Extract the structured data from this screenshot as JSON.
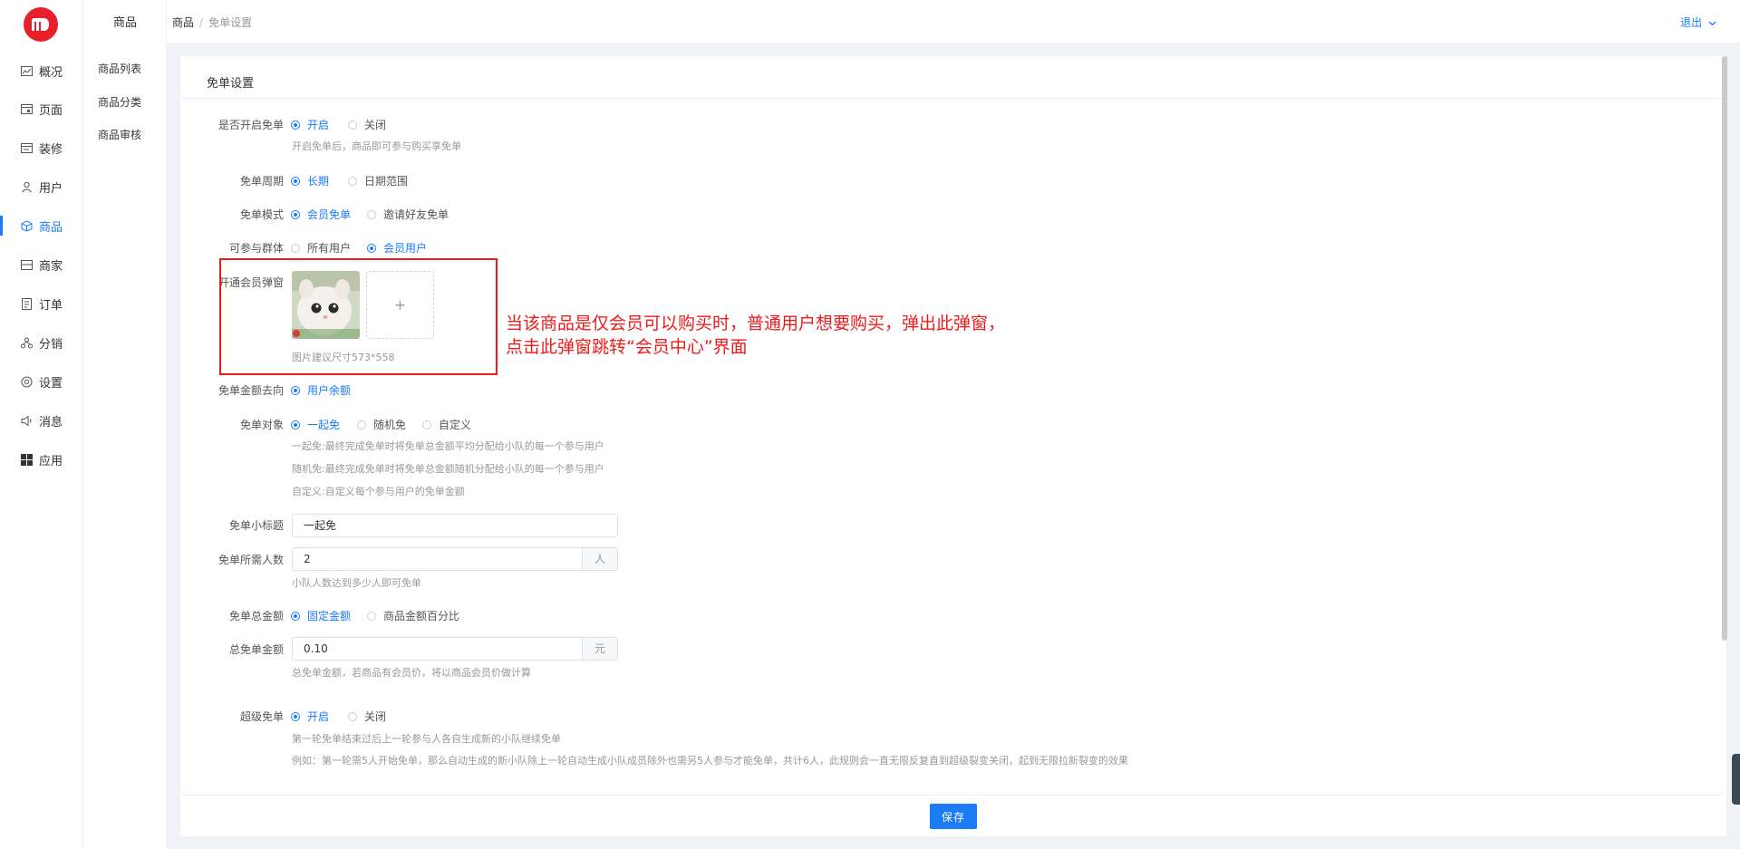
{
  "nav": {
    "items": [
      {
        "label": "概况",
        "icon": "chart-icon"
      },
      {
        "label": "页面",
        "icon": "page-icon"
      },
      {
        "label": "装修",
        "icon": "decorate-icon"
      },
      {
        "label": "用户",
        "icon": "user-icon"
      },
      {
        "label": "商品",
        "icon": "box-icon"
      },
      {
        "label": "商家",
        "icon": "store-icon"
      },
      {
        "label": "订单",
        "icon": "order-icon"
      },
      {
        "label": "分销",
        "icon": "distribution-icon"
      },
      {
        "label": "设置",
        "icon": "settings-icon"
      },
      {
        "label": "消息",
        "icon": "message-icon"
      },
      {
        "label": "应用",
        "icon": "apps-icon"
      }
    ],
    "active": "商品"
  },
  "subnav": {
    "title": "商品",
    "items": [
      "商品列表",
      "商品分类",
      "商品审核"
    ]
  },
  "topbar": {
    "breadcrumb": [
      "商品",
      "免单设置"
    ],
    "logout": "退出"
  },
  "card": {
    "title": "免单设置"
  },
  "form": {
    "enable": {
      "label": "是否开启免单",
      "options": [
        "开启",
        "关闭"
      ],
      "selected": "开启",
      "hint": "开启免单后，商品即可参与购买享免单"
    },
    "period": {
      "label": "免单周期",
      "options": [
        "长期",
        "日期范围"
      ],
      "selected": "长期"
    },
    "mode": {
      "label": "免单模式",
      "options": [
        "会员免单",
        "邀请好友免单"
      ],
      "selected": "会员免单"
    },
    "group": {
      "label": "可参与群体",
      "options": [
        "所有用户",
        "会员用户"
      ],
      "selected": "会员用户"
    },
    "popup": {
      "label": "开通会员弹窗",
      "hint": "图片建议尺寸573*558",
      "upload": "+"
    },
    "destination": {
      "label": "免单金额去向",
      "options": [
        "用户余额"
      ],
      "selected": "用户余额"
    },
    "target": {
      "label": "免单对象",
      "options": [
        "一起免",
        "随机免",
        "自定义"
      ],
      "selected": "一起免",
      "hints": [
        "一起免:最终完成免单时将免单总金额平均分配给小队的每一个参与用户",
        "随机免:最终完成免单时将免单总金额随机分配给小队的每一个参与用户",
        "自定义:自定义每个参与用户的免单金额"
      ]
    },
    "subtitle": {
      "label": "免单小标题",
      "value": "一起免"
    },
    "people": {
      "label": "免单所需人数",
      "value": "2",
      "unit": "人",
      "hint": "小队人数达到多少人即可免单"
    },
    "total_type": {
      "label": "免单总金额",
      "options": [
        "固定金额",
        "商品金额百分比"
      ],
      "selected": "固定金额"
    },
    "total_amount": {
      "label": "总免单金额",
      "value": "0.10",
      "unit": "元",
      "hint": "总免单金额，若商品有会员价，将以商品会员价做计算"
    },
    "super": {
      "label": "超级免单",
      "options": [
        "开启",
        "关闭"
      ],
      "selected": "开启",
      "hints": [
        "第一轮免单结束过后上一轮参与人各自生成新的小队继续免单",
        "例如：第一轮需5人开始免单，那么自动生成的新小队除上一轮自动生成小队成员除外也需另5人参与才能免单，共计6人，此规则会一直无限反复直到超级裂变关闭，起到无限拉新裂变的效果"
      ]
    }
  },
  "annotation": {
    "line1": "当该商品是仅会员可以购买时，普通用户想要购买，弹出此弹窗，",
    "line2": "点击此弹窗跳转“会员中心”界面",
    "color": "#ee1c1c"
  },
  "footer": {
    "save": "保存"
  },
  "colors": {
    "primary": "#1b7cf5",
    "brand_logo": "#e8202a"
  }
}
